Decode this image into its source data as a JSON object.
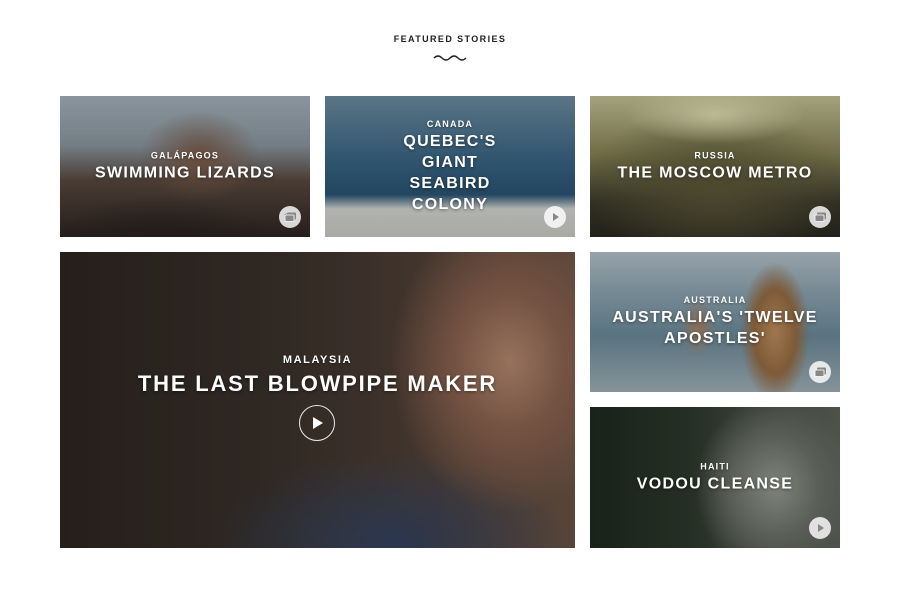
{
  "section": {
    "title": "FEATURED STORIES"
  },
  "stories": [
    {
      "country": "GALÁPAGOS",
      "title": "SWIMMING LIZARDS",
      "media": "gallery-icon"
    },
    {
      "country": "CANADA",
      "title": "QUEBEC'S GIANT SEABIRD COLONY",
      "media": "play-icon"
    },
    {
      "country": "RUSSIA",
      "title": "THE MOSCOW METRO",
      "media": "gallery-icon"
    },
    {
      "country": "MALAYSIA",
      "title": "THE LAST BLOWPIPE MAKER",
      "media": "play-icon"
    },
    {
      "country": "AUSTRALIA",
      "title": "AUSTRALIA'S 'TWELVE APOSTLES'",
      "media": "gallery-icon"
    },
    {
      "country": "HAITI",
      "title": "VODOU CLEANSE",
      "media": "play-icon"
    }
  ]
}
